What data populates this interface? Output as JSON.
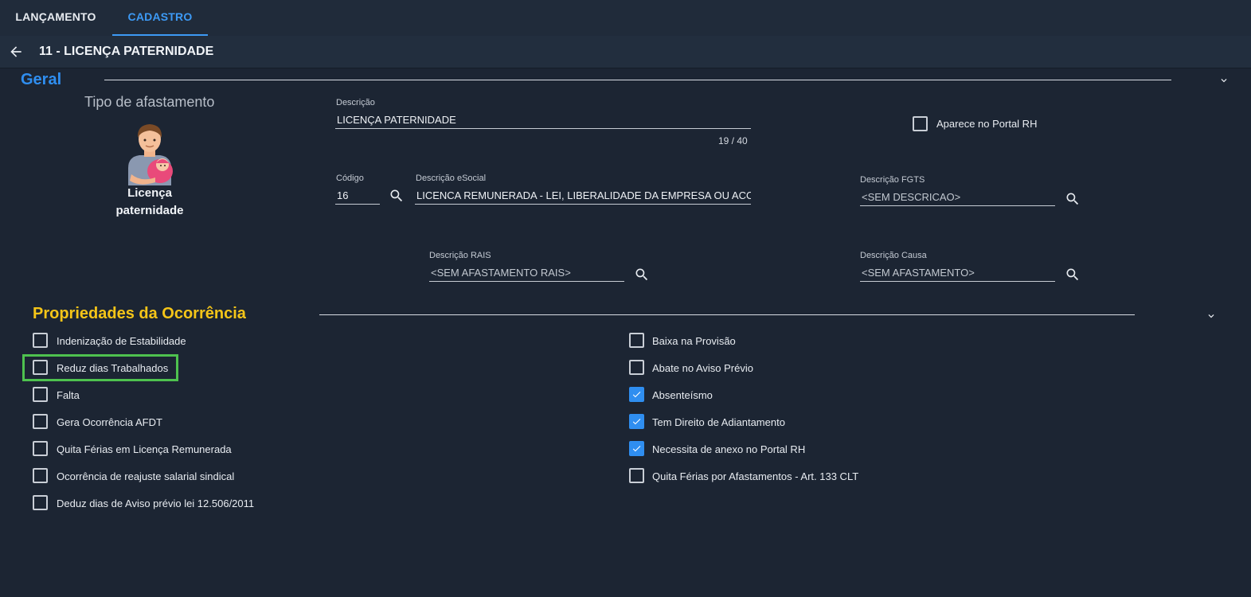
{
  "tabs": [
    {
      "label": "LANÇAMENTO",
      "active": false
    },
    {
      "label": "CADASTRO",
      "active": true
    }
  ],
  "page_title": "11 - LICENÇA PATERNIDADE",
  "sections": {
    "geral": "Geral",
    "propriedades": "Propriedades da Ocorrência"
  },
  "tipo_afastamento": {
    "label": "Tipo de afastamento",
    "name_line1": "Licença",
    "name_line2": "paternidade"
  },
  "fields": {
    "descricao": {
      "label": "Descrição",
      "value": "LICENÇA PATERNIDADE",
      "counter": "19 / 40"
    },
    "codigo": {
      "label": "Código",
      "value": "16"
    },
    "descricao_esocial": {
      "label": "Descrição eSocial",
      "value": "LICENCA REMUNERADA - LEI, LIBERALIDADE DA EMPRESA OU ACORDO/CONVENÇÃO COLETIVA DE TRABALHO"
    },
    "descricao_fgts": {
      "label": "Descrição FGTS",
      "value": "<SEM DESCRICAO>"
    },
    "descricao_rais": {
      "label": "Descrição RAIS",
      "value": "<SEM AFASTAMENTO RAIS>"
    },
    "descricao_causa": {
      "label": "Descrição Causa",
      "value": "<SEM AFASTAMENTO>"
    }
  },
  "portal_rh": {
    "label": "Aparece no Portal RH",
    "checked": false
  },
  "checkboxes_left": [
    {
      "label": "Indenização de Estabilidade",
      "checked": false
    },
    {
      "label": "Reduz dias Trabalhados",
      "checked": false
    },
    {
      "label": "Falta",
      "checked": false
    },
    {
      "label": "Gera Ocorrência AFDT",
      "checked": false
    },
    {
      "label": "Quita Férias em Licença Remunerada",
      "checked": false
    },
    {
      "label": "Ocorrência de reajuste salarial sindical",
      "checked": false
    },
    {
      "label": "Deduz dias de Aviso prévio lei 12.506/2011",
      "checked": false
    }
  ],
  "checkboxes_right": [
    {
      "label": "Baixa na Provisão",
      "checked": false
    },
    {
      "label": "Abate no Aviso Prévio",
      "checked": false
    },
    {
      "label": "Absenteísmo",
      "checked": true
    },
    {
      "label": "Tem Direito de Adiantamento",
      "checked": true
    },
    {
      "label": "Necessita de anexo no Portal RH",
      "checked": true
    },
    {
      "label": "Quita Férias por Afastamentos - Art. 133 CLT",
      "checked": false
    }
  ],
  "colors": {
    "background": "#1c2533",
    "accent_blue": "#2f8ef0",
    "section_yellow": "#f5c518",
    "highlight_green": "#4ec24f"
  }
}
